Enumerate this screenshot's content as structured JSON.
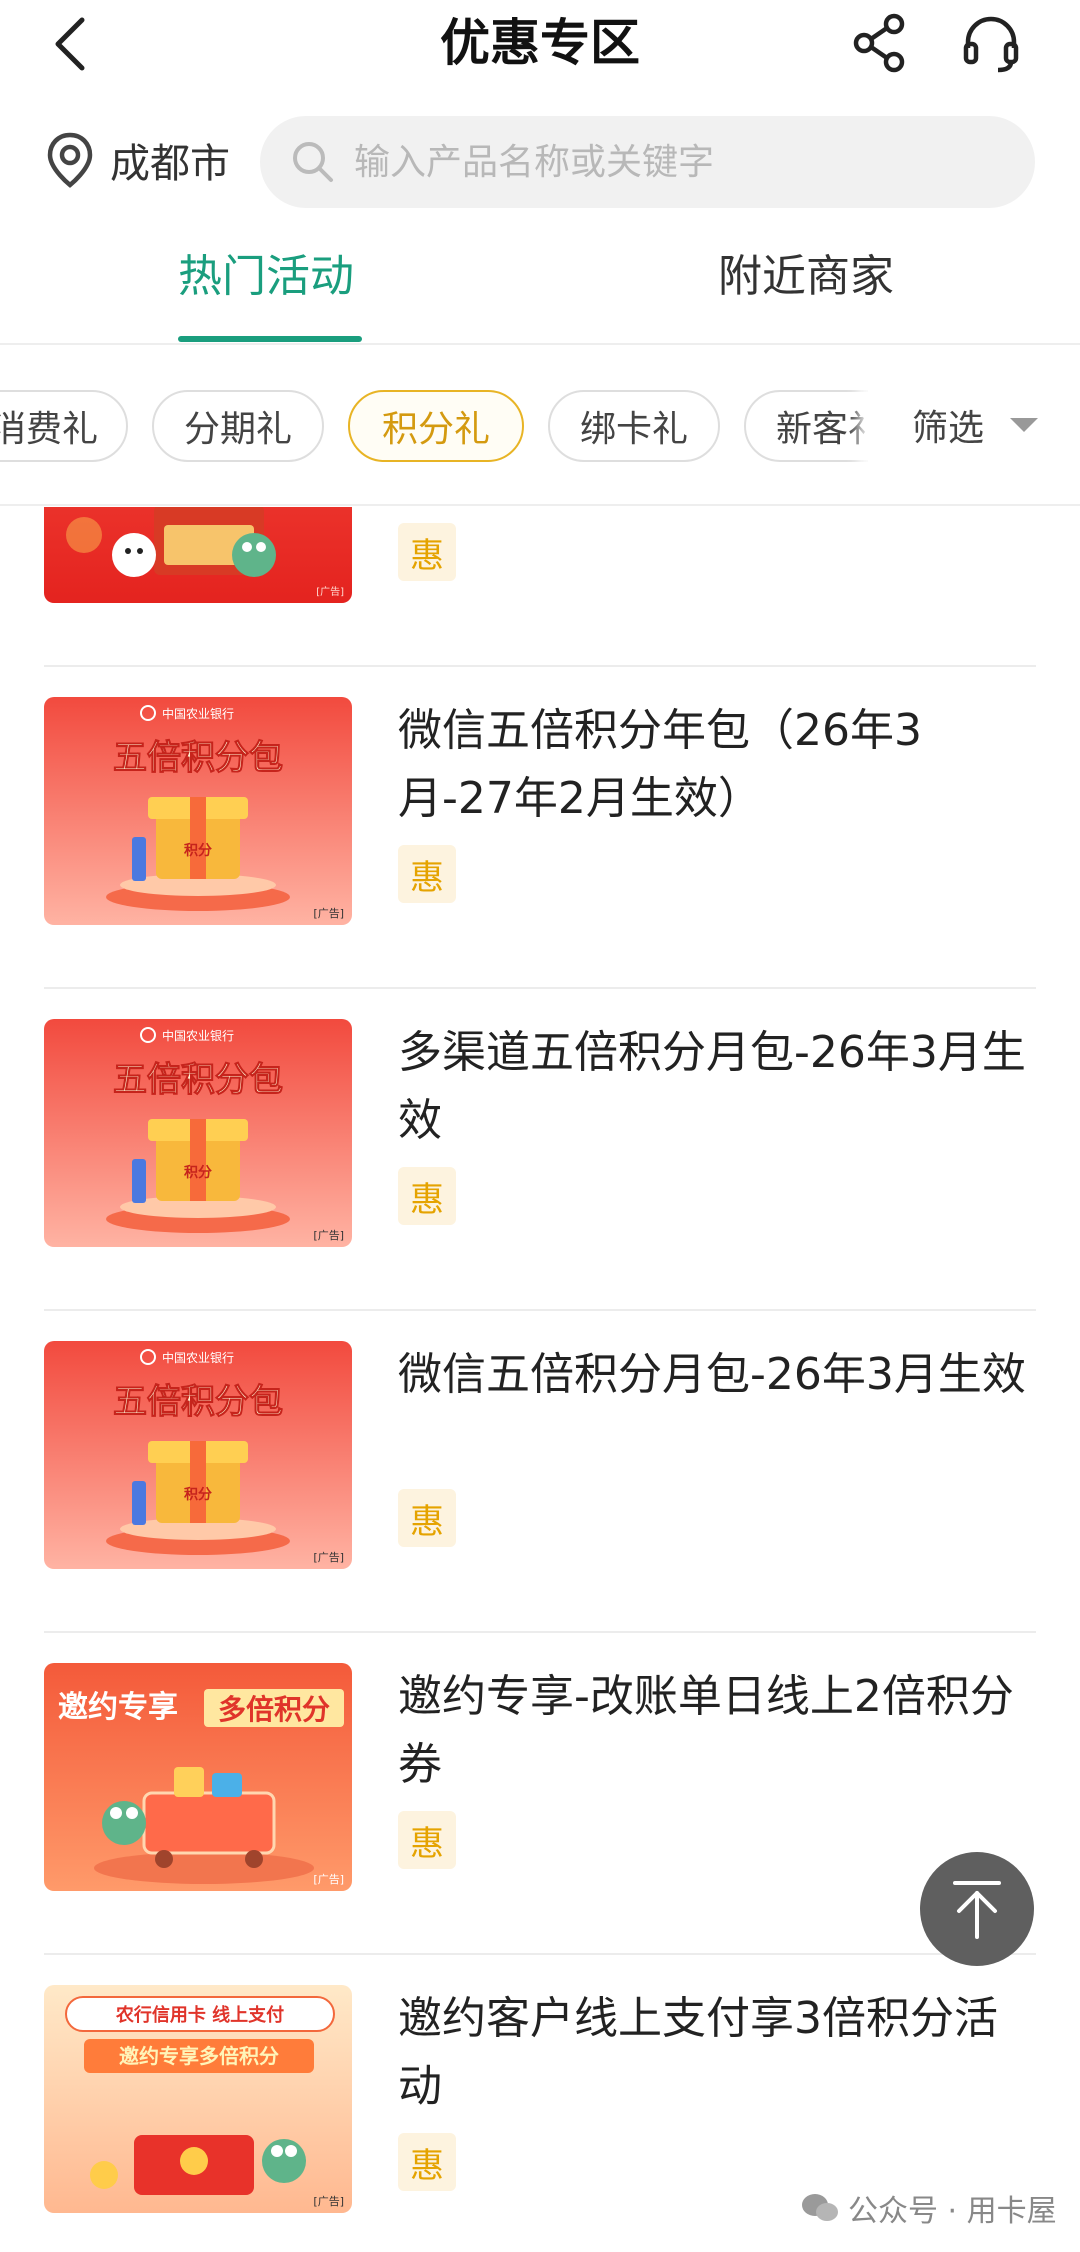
{
  "header": {
    "title": "优惠专区"
  },
  "location": {
    "city": "成都市"
  },
  "search": {
    "placeholder": "输入产品名称或关键字",
    "value": ""
  },
  "tabs": [
    {
      "label": "热门活动",
      "active": true
    },
    {
      "label": "附近商家",
      "active": false
    }
  ],
  "filters": {
    "chips": [
      {
        "label": "消费礼",
        "active": false
      },
      {
        "label": "分期礼",
        "active": false
      },
      {
        "label": "积分礼",
        "active": true
      },
      {
        "label": "绑卡礼",
        "active": false
      },
      {
        "label": "新客礼",
        "active": false
      }
    ],
    "filter_label": "筛选"
  },
  "items": [
    {
      "title": "",
      "badge": "惠",
      "image": "jd-gift-ad",
      "ad_tag": "[广告]"
    },
    {
      "title": "微信五倍积分年包（26年3月-27年2月生效）",
      "badge": "惠",
      "image": "five-times-points-pack",
      "banner_text": "五倍积分包",
      "bank_text": "中国农业银行",
      "gift_text": "积分",
      "ad_tag": "[广告]"
    },
    {
      "title": "多渠道五倍积分月包-26年3月生效",
      "badge": "惠",
      "image": "five-times-points-pack",
      "banner_text": "五倍积分包",
      "bank_text": "中国农业银行",
      "gift_text": "积分",
      "ad_tag": "[广告]"
    },
    {
      "title": "微信五倍积分月包-26年3月生效",
      "badge": "惠",
      "image": "five-times-points-pack",
      "banner_text": "五倍积分包",
      "bank_text": "中国农业银行",
      "gift_text": "积分",
      "ad_tag": "[广告]"
    },
    {
      "title": "邀约专享-改账单日线上2倍积分券",
      "badge": "惠",
      "image": "invite-multi-points",
      "banner_text_a": "邀约专享",
      "banner_text_b": "多倍积分",
      "ad_tag": "[广告]"
    },
    {
      "title": "邀约客户线上支付享3倍积分活动",
      "badge": "惠",
      "image": "abc-online-pay",
      "banner_text_a": "农行信用卡 线上支付",
      "banner_text_b": "邀约专享多倍积分",
      "ad_tag": "[广告]"
    }
  ],
  "watermark": {
    "text": "公众号 · 用卡屋"
  },
  "colors": {
    "accent_green": "#1a9e7e",
    "chip_active": "#e8b425",
    "badge_text": "#e5a300",
    "badge_bg": "#fdf3df"
  },
  "icons": [
    "back-icon",
    "share-icon",
    "headset-icon",
    "location-pin-icon",
    "search-icon",
    "caret-down-icon",
    "arrow-up-icon",
    "wechat-icon"
  ]
}
